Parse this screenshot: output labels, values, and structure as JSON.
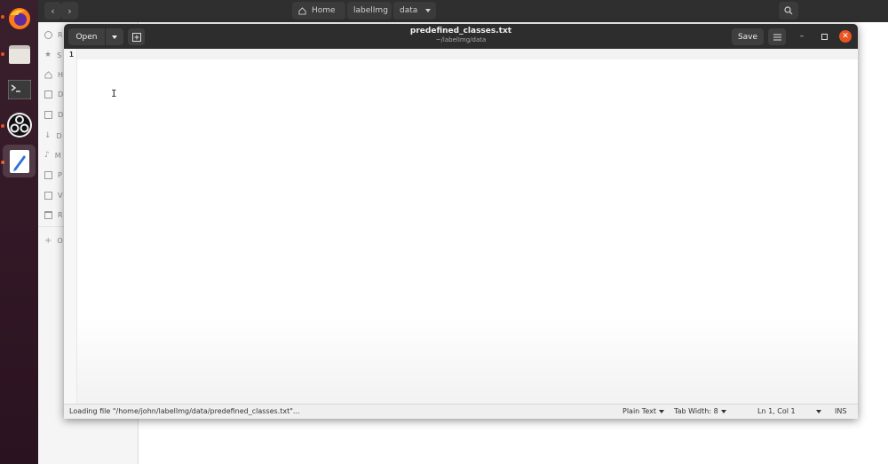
{
  "dock": {
    "apps": [
      {
        "name": "firefox",
        "active": false,
        "running": true
      },
      {
        "name": "files",
        "active": false,
        "running": true
      },
      {
        "name": "terminal",
        "active": false,
        "running": false
      },
      {
        "name": "obs-studio",
        "active": false,
        "running": true
      },
      {
        "name": "text-editor",
        "active": true,
        "running": true
      }
    ]
  },
  "file_manager": {
    "breadcrumbs": [
      "Home",
      "labelImg",
      "data"
    ],
    "sidebar_items": [
      {
        "icon": "recent-icon",
        "label": "R"
      },
      {
        "icon": "star-icon",
        "label": "S"
      },
      {
        "icon": "home-icon",
        "label": "H"
      },
      {
        "icon": "desktop-icon",
        "label": "D"
      },
      {
        "icon": "documents-icon",
        "label": "D"
      },
      {
        "icon": "downloads-icon",
        "label": "D"
      },
      {
        "icon": "music-icon",
        "label": "M"
      },
      {
        "icon": "pictures-icon",
        "label": "P"
      },
      {
        "icon": "videos-icon",
        "label": "V"
      },
      {
        "icon": "trash-icon",
        "label": "R"
      },
      {
        "icon": "plus-icon",
        "label": "O"
      }
    ]
  },
  "editor": {
    "open_label": "Open",
    "title": "predefined_classes.txt",
    "subtitle": "~/labelImg/data",
    "save_label": "Save",
    "line_numbers": [
      "1"
    ],
    "status": {
      "message": "Loading file \"/home/john/labelImg/data/predefined_classes.txt\"...",
      "language": "Plain Text",
      "tab_width": "Tab Width: 8",
      "position": "Ln 1, Col 1",
      "mode": "INS"
    }
  },
  "colors": {
    "accent": "#e95420",
    "headerbar": "#2d2d2d",
    "dock": "#2b1220"
  }
}
